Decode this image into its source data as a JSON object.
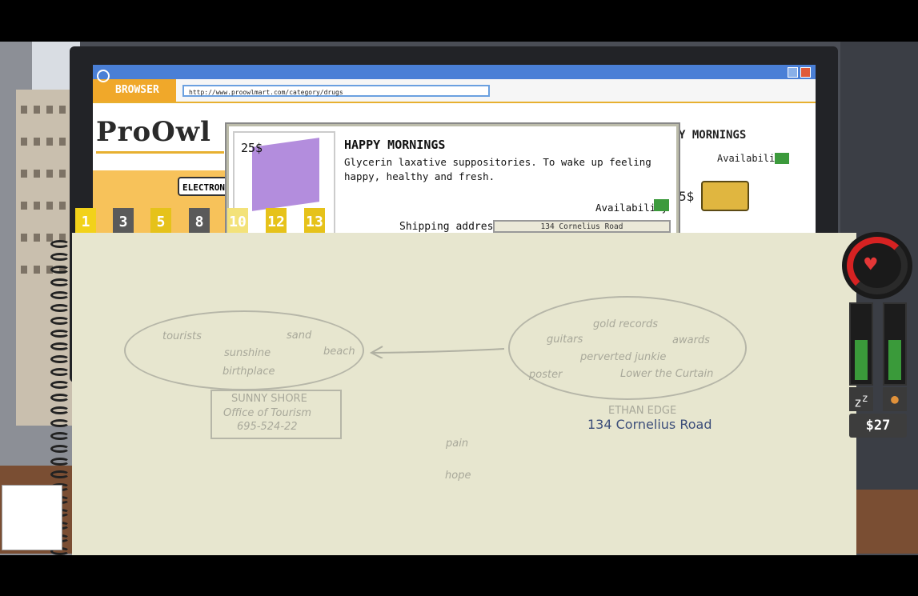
{
  "browser": {
    "badge_label": "BROWSER",
    "url": "http://www.proowlmart.com/category/drugs",
    "logo_text": "ProOwl",
    "category_button": "ELECTRON",
    "bg_product_title": "Y MORNINGS",
    "bg_availability": "Availability",
    "bg_price": "5$"
  },
  "popup": {
    "price": "25$",
    "title": "HAPPY MORNINGS",
    "description": "Glycerin laxative suppositories. To wake up feeling happy, healthy and fresh.",
    "availability_label": "Availability",
    "shipping_label": "Shipping address",
    "shipping_value": "134 Cornelius Road"
  },
  "tabs": [
    {
      "label": "1",
      "color": "#f2d21a"
    },
    {
      "label": "3",
      "color": "#5a5a5a"
    },
    {
      "label": "5",
      "color": "#e6c21a"
    },
    {
      "label": "8",
      "color": "#5a5a5a"
    },
    {
      "label": "10",
      "color": "#f3e27a"
    },
    {
      "label": "12",
      "color": "#e6c21a"
    },
    {
      "label": "13",
      "color": "#e6c21a"
    }
  ],
  "notebook": {
    "left_bubble": [
      "tourists",
      "sand",
      "sunshine",
      "beach",
      "birthplace"
    ],
    "card_lines": [
      "SUNNY SHORE",
      "Office of Tourism",
      "695-524-22"
    ],
    "right_bubble": [
      "gold records",
      "guitars",
      "awards",
      "perverted junkie",
      "poster",
      "Lower the Curtain"
    ],
    "person_name": "ETHAN EDGE",
    "person_address": "134 Cornelius Road",
    "loose_words": [
      "pain",
      "hope"
    ]
  },
  "hud": {
    "money": "$27",
    "sleep_icon": "zzz-icon",
    "food_icon": "drumstick-icon",
    "heart_icon": "heart-icon",
    "sleep_level": 0.55,
    "food_level": 0.55
  }
}
